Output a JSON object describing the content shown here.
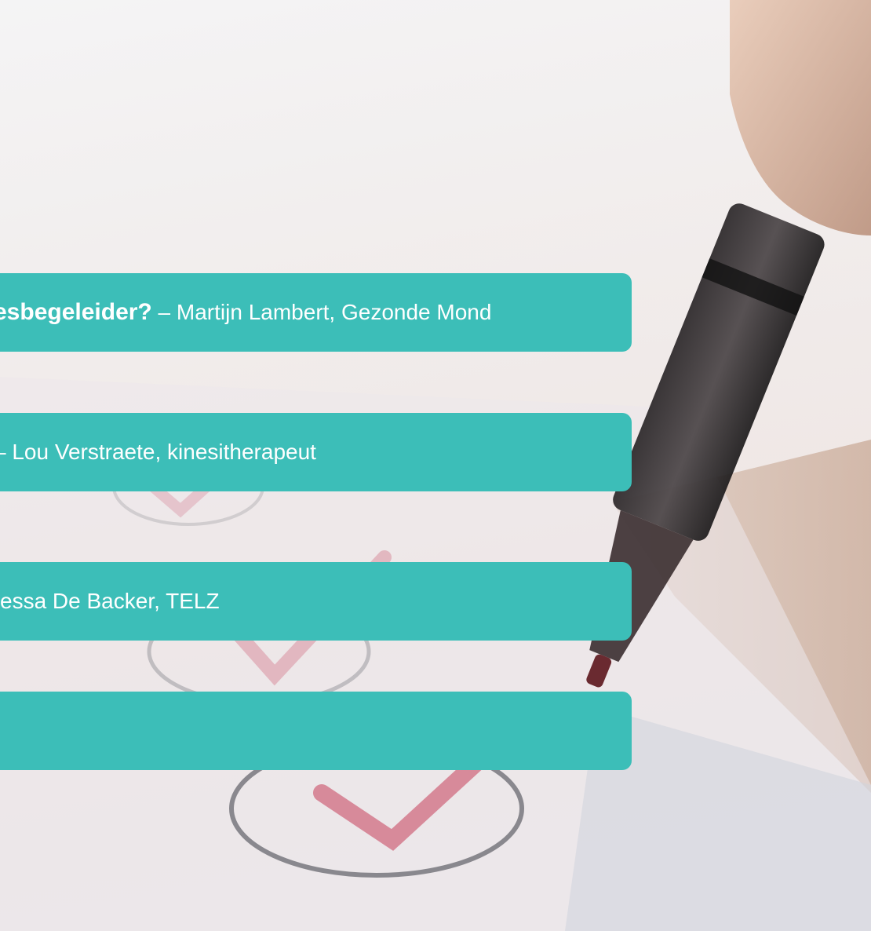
{
  "accent_color": "#3cbeb8",
  "testimonials": [
    {
      "question": "esbegeleider?",
      "separator": " – ",
      "author": "Martijn Lambert, Gezonde Mond"
    },
    {
      "question": "",
      "separator": "– ",
      "author": "Lou Verstraete, kinesitherapeut"
    },
    {
      "question": "",
      "separator": "",
      "author": "essa De Backer, TELZ"
    },
    {
      "question": "",
      "separator": "",
      "author": ""
    }
  ]
}
